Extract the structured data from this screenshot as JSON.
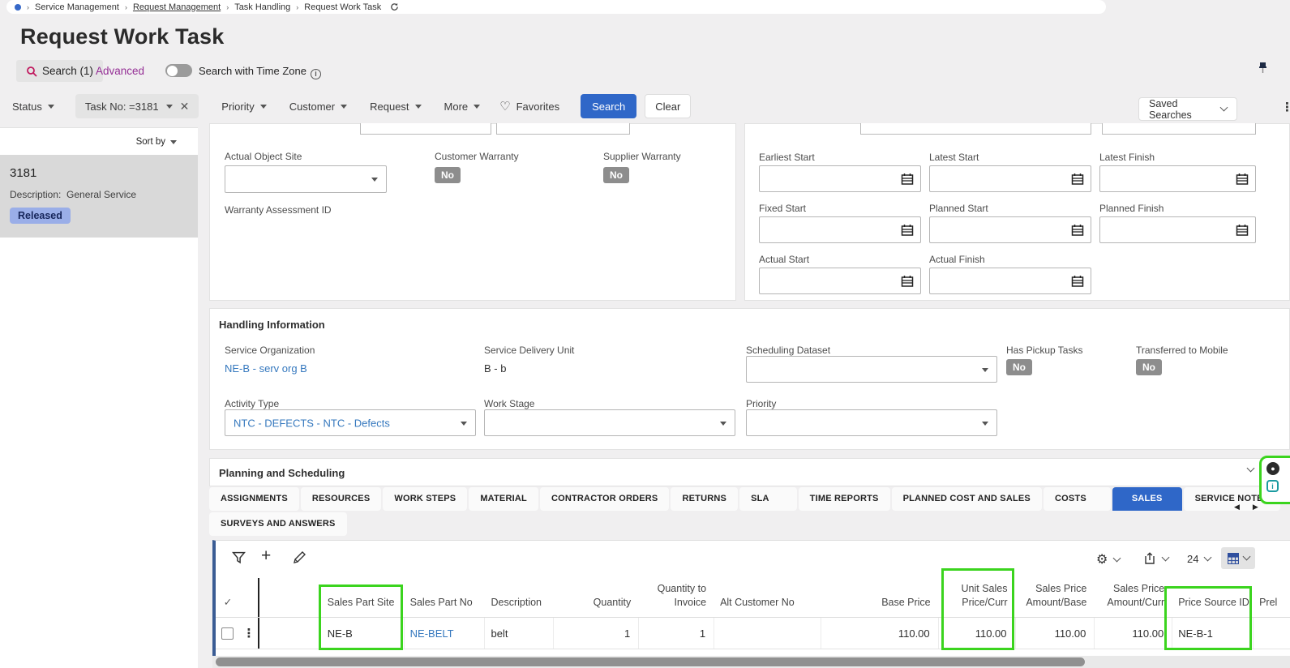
{
  "breadcrumb": {
    "items": [
      "Service Management",
      "Request Management",
      "Task Handling",
      "Request Work Task"
    ]
  },
  "page_title": "Request Work Task",
  "search_panel": {
    "search_tab": "Search (1)",
    "advanced_tab": "Advanced",
    "timezone_toggle": "Search with Time Zone",
    "filters": {
      "status": "Status",
      "task_no_chip": "Task No: =3181",
      "priority": "Priority",
      "customer": "Customer",
      "request": "Request",
      "more": "More",
      "favorites": "Favorites"
    },
    "buttons": {
      "search": "Search",
      "clear": "Clear",
      "saved_searches": "Saved Searches"
    }
  },
  "sidebar": {
    "sort_by": "Sort by",
    "selected_item": {
      "task_no": "3181",
      "description_label": "Description:",
      "description_value": "General Service",
      "status_badge": "Released"
    }
  },
  "task_form": {
    "actual_object_site_label": "Actual Object Site",
    "customer_warranty_label": "Customer Warranty",
    "customer_warranty_value": "No",
    "supplier_warranty_label": "Supplier Warranty",
    "supplier_warranty_value": "No",
    "warranty_assessment_id_label": "Warranty Assessment ID",
    "date_fields": [
      "Earliest Start",
      "Latest Start",
      "Latest Finish",
      "Fixed Start",
      "Planned Start",
      "Planned Finish",
      "Actual Start",
      "Actual Finish"
    ]
  },
  "handling_information": {
    "title": "Handling Information",
    "service_organization_label": "Service Organization",
    "service_organization_value": "NE-B - serv org B",
    "service_delivery_unit_label": "Service Delivery Unit",
    "service_delivery_unit_value": "B - b",
    "scheduling_dataset_label": "Scheduling Dataset",
    "has_pickup_tasks_label": "Has Pickup Tasks",
    "has_pickup_tasks_value": "No",
    "transferred_to_mobile_label": "Transferred to Mobile",
    "transferred_to_mobile_value": "No",
    "activity_type_label": "Activity Type",
    "activity_type_value": "NTC - DEFECTS - NTC - Defects",
    "work_stage_label": "Work Stage",
    "priority_label": "Priority"
  },
  "planning_section": {
    "title": "Planning and Scheduling",
    "tabs": [
      "ASSIGNMENTS",
      "RESOURCES",
      "WORK STEPS",
      "MATERIAL",
      "CONTRACTOR ORDERS",
      "RETURNS",
      "SLA",
      "TIME REPORTS",
      "PLANNED COST AND SALES",
      "COSTS",
      "SALES",
      "SERVICE NOTES"
    ],
    "tabs_row2": [
      "SURVEYS AND ANSWERS"
    ],
    "active_tab": "SALES"
  },
  "sales_table": {
    "page_size": "24",
    "columns": [
      {
        "label": "Sales Part Site"
      },
      {
        "label": "Sales Part No"
      },
      {
        "label": "Description"
      },
      {
        "label": "Quantity"
      },
      {
        "label": "Quantity to Invoice"
      },
      {
        "label": "Alt Customer No"
      },
      {
        "label": "Base Price"
      },
      {
        "label": "Unit Sales Price/Curr"
      },
      {
        "label": "Sales Price Amount/Base"
      },
      {
        "label": "Sales Price Amount/Curr"
      },
      {
        "label": "Price Source ID"
      },
      {
        "label": "Prel"
      }
    ],
    "rows": [
      {
        "sales_part_site": "NE-B",
        "sales_part_no": "NE-BELT",
        "description": "belt",
        "quantity": "1",
        "quantity_to_invoice": "1",
        "alt_customer_no": "",
        "base_price": "110.00",
        "unit_sales_price_curr": "110.00",
        "sales_price_amount_base": "110.00",
        "sales_price_amount_curr": "110.00",
        "price_source_id": "NE-B-1"
      }
    ]
  }
}
